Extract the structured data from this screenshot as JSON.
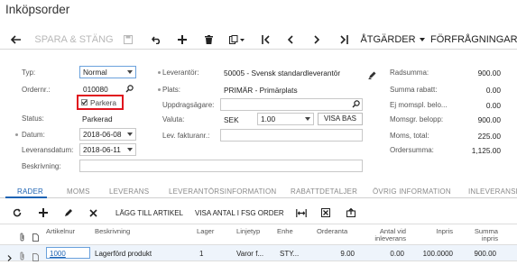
{
  "page": {
    "title": "Inköpsorder"
  },
  "toolbar": {
    "save_close_label": "SPARA & STÄNG",
    "actions_label": "ÅTGÄRDER",
    "inquiries_label": "FÖRFRÅGNINGAR"
  },
  "form": {
    "type_label": "Typ:",
    "type_value": "Normal",
    "order_no_label": "Ordernr.:",
    "order_no_value": "010080",
    "park_label": "Parkera",
    "status_label": "Status:",
    "status_value": "Parkerad",
    "date_label": "Datum:",
    "date_value": "2018-06-08",
    "delivery_date_label": "Leveransdatum:",
    "delivery_date_value": "2018-06-11",
    "description_label": "Beskrivning:",
    "description_value": "",
    "supplier_label": "Leverantör:",
    "supplier_value": "50005 - Svensk standardleverantör",
    "location_label": "Plats:",
    "location_value": "PRIMÄR - Primärplats",
    "assignee_label": "Uppdragsägare:",
    "assignee_value": "",
    "currency_label": "Valuta:",
    "currency_value": "SEK",
    "rate_value": "1.00",
    "rate_button": "VISA BAS",
    "supplier_invoice_label": "Lev. fakturanr.:",
    "supplier_invoice_value": ""
  },
  "totals": [
    {
      "label": "Radsumma:",
      "value": "900.00"
    },
    {
      "label": "Summa rabatt:",
      "value": "0.00"
    },
    {
      "label": "Ej momspl. belo...",
      "value": "0.00"
    },
    {
      "label": "Momsgr. belopp:",
      "value": "900.00"
    },
    {
      "label": "Moms, total:",
      "value": "225.00"
    },
    {
      "label": "Ordersumma:",
      "value": "1,125.00"
    }
  ],
  "tabs": [
    "RADER",
    "MOMS",
    "LEVERANS",
    "LEVERANTÖRSINFORMATION",
    "RABATTDETALJER",
    "ÖVRIG INFORMATION",
    "INLEVERANSE"
  ],
  "grid_toolbar": {
    "add_item": "LÄGG TILL ARTIKEL",
    "show_qty": "VISA ANTAL I FSG ORDER"
  },
  "grid": {
    "headers": {
      "item": "Artikelnur",
      "description": "Beskrivning",
      "warehouse": "Lager",
      "line_type": "Linjetyp",
      "unit": "Enhe",
      "ordered_qty": "Orderanta",
      "received_qty_1": "Antal vid",
      "received_qty_2": "inleverans",
      "unit_price": "Inpris",
      "total_1": "Summa",
      "total_2": "inpris"
    },
    "rows": [
      {
        "item": "1000",
        "description": "Lagerförd produkt",
        "warehouse": "1",
        "line_type": "Varor f...",
        "unit": "STY...",
        "ordered_qty": "9.00",
        "received_qty": "0.00",
        "unit_price": "100.0000",
        "total": "900.00"
      }
    ]
  },
  "colors": {
    "accent": "#1d63b3",
    "highlight_box": "#e0141e",
    "row_bg": "#eef4fb"
  }
}
